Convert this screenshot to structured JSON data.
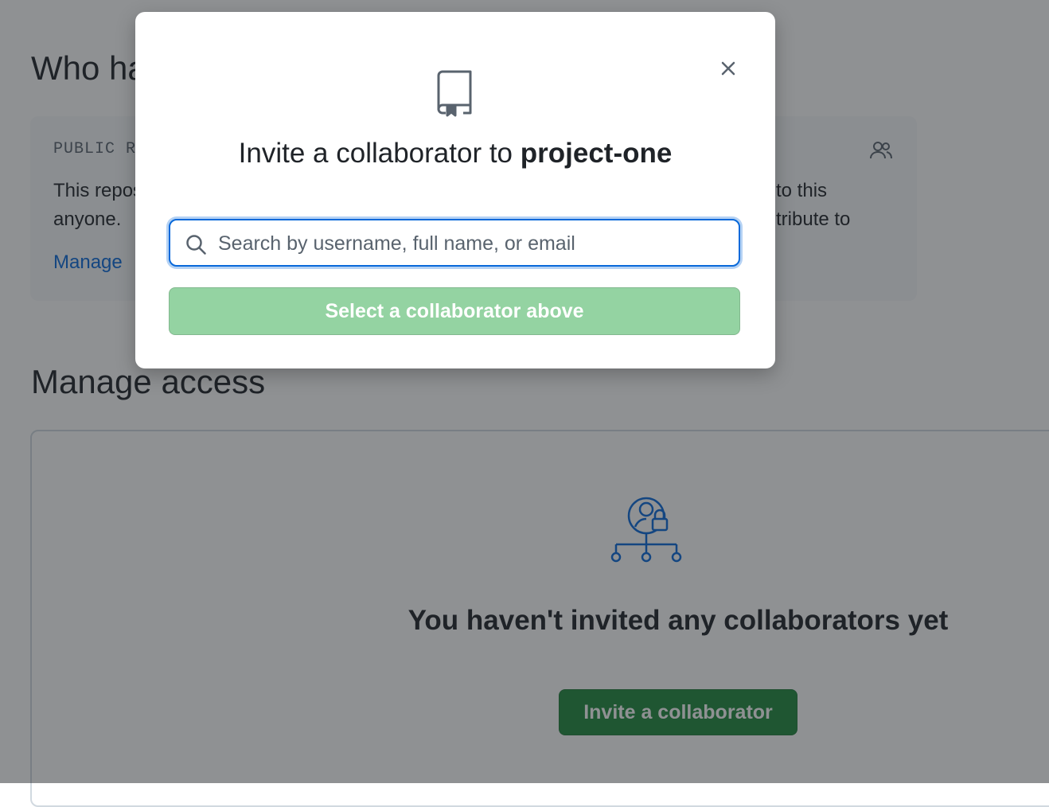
{
  "page": {
    "who_heading": "Who has access",
    "public_box": {
      "label": "PUBLIC REPOSITORY",
      "line1_left": "This repository is public and visible to",
      "line2_left": "anyone.",
      "line1_right": "to this",
      "line2_right": "tribute to",
      "manage_link": "Manage"
    },
    "manage_heading": "Manage access",
    "empty_state": {
      "title": "You haven't invited any collaborators yet",
      "invite_button": "Invite a collaborator"
    }
  },
  "dialog": {
    "title_prefix": "Invite a collaborator to",
    "repo_name": "project-one",
    "search_placeholder": "Search by username, full name, or email",
    "submit_label": "Select a collaborator above",
    "close_icon": "x-icon",
    "repo_icon": "repo-icon"
  },
  "colors": {
    "accent_blue": "#0969da",
    "primary_green": "#1f883d",
    "disabled_green": "#94d3a2"
  }
}
